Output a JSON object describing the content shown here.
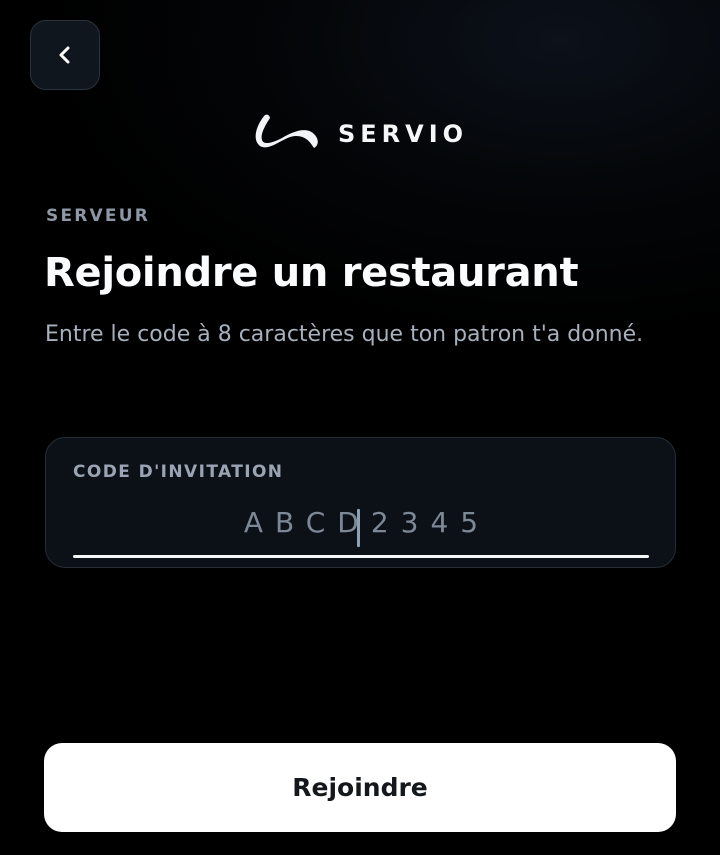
{
  "header": {
    "back_icon": "chevron-left-icon",
    "brand_name": "SERVIO",
    "logo_icon": "servio-swoosh-logo"
  },
  "content": {
    "overline": "SERVEUR",
    "title": "Rejoindre un restaurant",
    "subtitle": "Entre le code à 8 caractères que ton patron t'a donné."
  },
  "invite": {
    "label": "CODE D'INVITATION",
    "value": "",
    "placeholder": "ABCD2345"
  },
  "actions": {
    "join_label": "Rejoindre"
  },
  "colors": {
    "background": "#000000",
    "button_bg": "#ffffff",
    "button_text": "#14181d",
    "muted_text": "#a7b0bd",
    "card_bg": "#0c1118"
  }
}
